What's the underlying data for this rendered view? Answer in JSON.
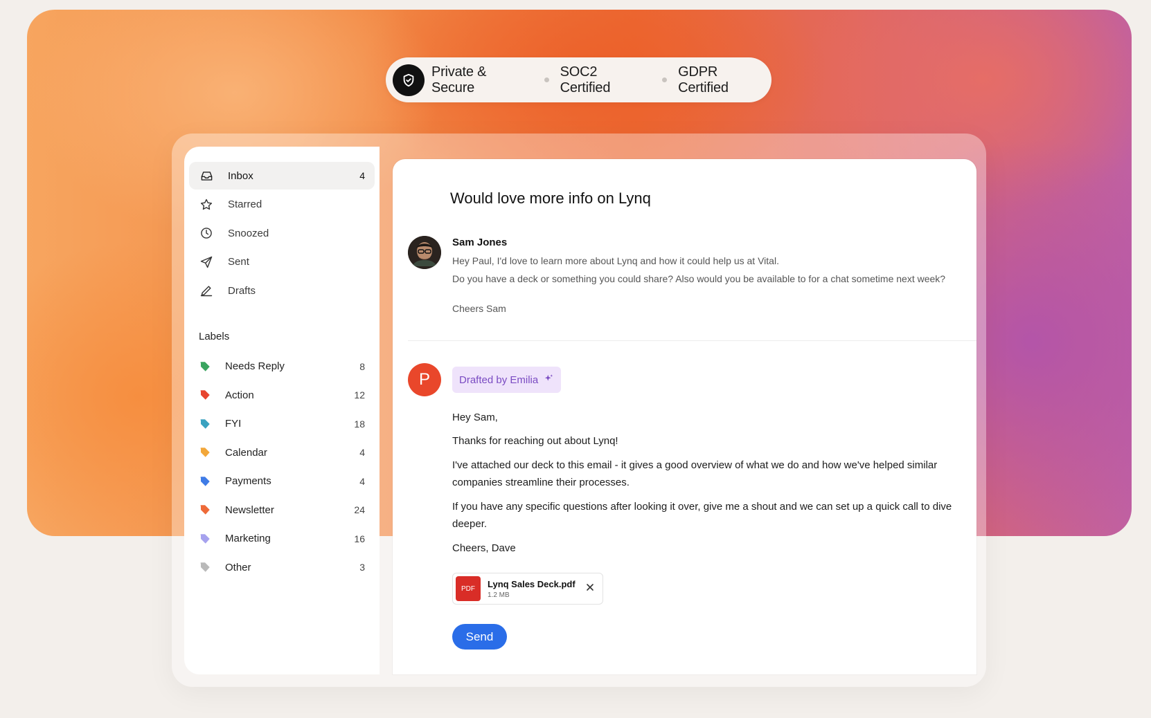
{
  "trust": {
    "items": [
      "Private & Secure",
      "SOC2 Certified",
      "GDPR Certified"
    ]
  },
  "sidebar": {
    "nav": [
      {
        "label": "Inbox",
        "count": "4",
        "icon": "inbox-icon"
      },
      {
        "label": "Starred",
        "count": "",
        "icon": "star-icon"
      },
      {
        "label": "Snoozed",
        "count": "",
        "icon": "clock-icon"
      },
      {
        "label": "Sent",
        "count": "",
        "icon": "send-icon"
      },
      {
        "label": "Drafts",
        "count": "",
        "icon": "pencil-icon"
      }
    ],
    "labels_title": "Labels",
    "labels": [
      {
        "label": "Needs Reply",
        "count": "8",
        "color": "#3aa45f"
      },
      {
        "label": "Action",
        "count": "12",
        "color": "#e7442e"
      },
      {
        "label": "FYI",
        "count": "18",
        "color": "#3aa2c0"
      },
      {
        "label": "Calendar",
        "count": "4",
        "color": "#f2a73a"
      },
      {
        "label": "Payments",
        "count": "4",
        "color": "#3f7be6"
      },
      {
        "label": "Newsletter",
        "count": "24",
        "color": "#ee6a38"
      },
      {
        "label": "Marketing",
        "count": "16",
        "color": "#a6a2ee"
      },
      {
        "label": "Other",
        "count": "3",
        "color": "#b9b9b9"
      }
    ]
  },
  "email": {
    "subject": "Would love more info on Lynq",
    "sender": "Sam Jones",
    "body": [
      "Hey Paul, I'd love to learn more about Lynq and how it could help us at Vital.",
      "Do you have a deck or something you could share? Also would you be available to for a chat sometime next week?",
      "Cheers Sam"
    ]
  },
  "reply": {
    "avatar_letter": "P",
    "badge": "Drafted by Emilia",
    "lines": [
      "Hey Sam,",
      "Thanks for reaching out about Lynq!",
      "I've attached our deck to this email - it gives a good overview of what we do and how we've helped similar companies streamline their processes.",
      "If you have any specific questions after looking it over, give me a shout and we can set up a quick call to dive deeper.",
      "Cheers, Dave"
    ],
    "attachment": {
      "type": "PDF",
      "name": "Lynq Sales Deck.pdf",
      "size": "1.2 MB"
    },
    "send_label": "Send"
  },
  "colors": {
    "accent": "#2a6de8",
    "badge_bg": "#efe3fb",
    "badge_text": "#7a4bc2",
    "avatar_p": "#e9472b"
  }
}
